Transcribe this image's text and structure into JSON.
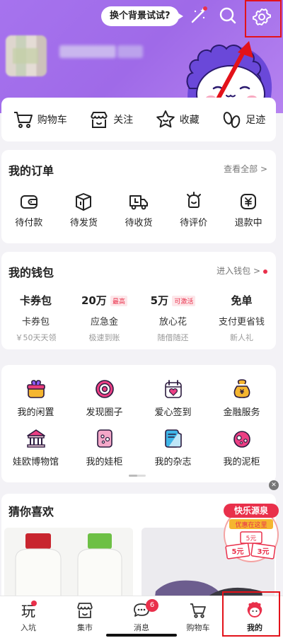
{
  "header": {
    "bubble_text": "换个背景试试?",
    "icons": [
      "magic-wand-icon",
      "search-icon",
      "gear-icon"
    ],
    "accent": "#a673ee"
  },
  "quick_links": [
    {
      "label": "购物车",
      "icon": "cart-icon"
    },
    {
      "label": "关注",
      "icon": "shop-icon"
    },
    {
      "label": "收藏",
      "icon": "star-icon"
    },
    {
      "label": "足迹",
      "icon": "footprint-icon"
    }
  ],
  "orders": {
    "title": "我的订单",
    "link": "查看全部 >",
    "items": [
      {
        "label": "待付款",
        "icon": "wallet-icon"
      },
      {
        "label": "待发货",
        "icon": "box-icon"
      },
      {
        "label": "待收货",
        "icon": "truck-icon"
      },
      {
        "label": "待评价",
        "icon": "review-icon"
      },
      {
        "label": "退款中",
        "icon": "refund-icon"
      }
    ]
  },
  "wallet": {
    "title": "我的钱包",
    "link": "进入钱包 >",
    "items": [
      {
        "top": "卡券包",
        "badge": "",
        "mid": "卡券包",
        "sub": "￥50天天领"
      },
      {
        "top": "20万",
        "badge": "最高",
        "mid": "应急金",
        "sub": "极速到账"
      },
      {
        "top": "5万",
        "badge": "可激活",
        "mid": "放心花",
        "sub": "随借随还"
      },
      {
        "top": "免单",
        "badge": "",
        "mid": "支付更省钱",
        "sub": "新人礼"
      }
    ]
  },
  "services": {
    "row1": [
      {
        "label": "我的闲置",
        "icon": "idle-goods-icon"
      },
      {
        "label": "发现圈子",
        "icon": "circle-icon"
      },
      {
        "label": "爱心签到",
        "icon": "heart-calendar-icon"
      },
      {
        "label": "金融服务",
        "icon": "money-bag-icon"
      }
    ],
    "row2": [
      {
        "label": "娃欧博物馆",
        "icon": "museum-icon"
      },
      {
        "label": "我的娃柜",
        "icon": "doll-cabinet-icon"
      },
      {
        "label": "我的杂志",
        "icon": "magazine-icon"
      },
      {
        "label": "我的泥柜",
        "icon": "clay-cabinet-icon"
      }
    ]
  },
  "guess": {
    "title": "猜你喜欢",
    "promo_title": "快乐源泉",
    "promo_sub": "优惠在这里",
    "promo_coupon1": "5元",
    "promo_coupon2": "3元"
  },
  "tabbar": [
    {
      "label": "入坑",
      "icon": "play-icon",
      "badge": ""
    },
    {
      "label": "集市",
      "icon": "market-icon",
      "badge": ""
    },
    {
      "label": "消息",
      "icon": "message-icon",
      "badge": "6"
    },
    {
      "label": "购物车",
      "icon": "cart-icon",
      "badge": ""
    },
    {
      "label": "我的",
      "icon": "mine-icon",
      "badge": ""
    }
  ]
}
